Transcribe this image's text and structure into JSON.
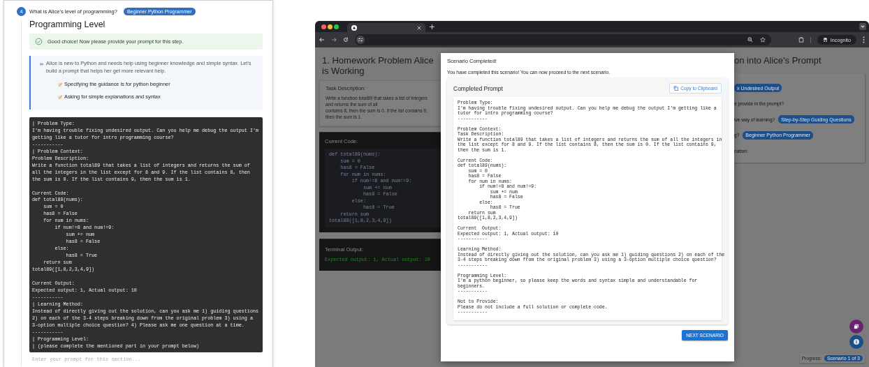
{
  "step": {
    "number": "4",
    "question": "What is Alice's level of programming?",
    "answer": "Beginner Python Programmer"
  },
  "section": {
    "title": "Programming Level",
    "success": "Good choice! Now please provide your prompt for this step.",
    "info": "Alice is new to Python and needs help using beginner knowledge and simple syntax. Let's build a prompt that helps her get more relevant help.",
    "tips": [
      "Specifying the guidance is for python beginner",
      "Asking for simple explanations and syntax"
    ],
    "prompt_preview": "| Problem Type:\nI'm having trouble fixing undesired output. Can you help me debug the output I'm\ngetting like a tutor for intro programming course?\n-----------\n| Problem Context:\nProblem Description:\nWrite a function total89 that takes a list of integers and returns the sum of\nall the integers in the list except for 8 and 9. If the list contains 8, then\nthe sum is 0. If the list contains 9, then the sum is 1.\n\nCurrent Code:\ndef total89(nums):\n    sum = 0\n    has8 = False\n    for num in nums:\n        if num!=8 and num!=9:\n            sum += num\n            has8 = False\n        else:\n            has8 = True\n    return sum\ntotal89([1,8,2,3,4,9])\n\nCurrent Output:\nExpected output: 1, Actual output: 10\n-----------\n| Learning Method:\nInstead of directly giving out the solution, can you ask me 1) guiding questions\n2) on each of the 3-4 steps breaking down from the original problem 3) using a\n3-option multiple choice question? 4) Please ask me one question at a time.\n-----------\n| Programming Level:\n| (please complete the mentioned part in your prompt below)",
    "input": {
      "placeholder": "Enter your prompt for this section..."
    }
  },
  "browser": {
    "incognito": "Incognito",
    "page": {
      "left": {
        "title": "1. Homework Problem Alice is Working",
        "task": {
          "heading": "Task Description:",
          "lines": [
            "Write a function total89 that takes a list of integers and returns the sum of all",
            "contains 8, then the sum is 0. If the list contains 9, then the sum is 1."
          ]
        },
        "code": {
          "heading": "Current Code:",
          "lines": [
            "def total89(nums):",
            "    sum = 0",
            "    has8 = False",
            "    for num in nums:",
            "        if num!=8 and num!=9:",
            "            sum += num",
            "            has8 = False",
            "        else:",
            "            has8 = True",
            "    return sum",
            "total89([1,8,2,3,4,9])"
          ]
        },
        "terminal": {
          "heading": "Terminal Output:",
          "text": "Expected output: 1, Actual output: 10"
        }
      },
      "right": {
        "title": "on into Alice's Prompt",
        "rows": [
          {
            "badge": "x Undesired Output"
          },
          {
            "text": "e provide in the prompt?"
          },
          {
            "text": "ive way of learning?",
            "badge": "Step-by-Step Guiding Questions"
          },
          {
            "text": "g?",
            "badge": "Beginner Python Programmer"
          },
          {
            "text": "nation:"
          }
        ]
      },
      "progress": {
        "label": "Progress:",
        "value": "Scenario 1 of 3"
      }
    },
    "dialog": {
      "title": "Scenario Completed!",
      "message": "You have completed this scenario! You can now proceed to the next scenario.",
      "card_title": "Completed Prompt",
      "copy_button": "Copy to Clipboard",
      "prompt": "Problem Type:\nI'm having trouble fixing undesired output. Can you help me debug the output I'm getting like a\ntutor for intro programming course?\n-----------\n\nProblem Context:\nTask Description:\nWrite a function total89 that takes a list of integers and returns the sum of all the integers in\nthe list except for 8 and 9. If the list contains 8, then the sum is 0. If the list contains 9,\nthen the sum is 1.\n\nCurrent Code:\ndef total89(nums):\n    sum = 0\n    has8 = False\n    for num in nums:\n        if num!=8 and num!=9:\n            sum += num\n            has8 = False\n        else:\n            has8 = True\n    return sum\ntotal89([1,8,2,3,4,9])\n\nCurrent  Output:\nExpected output: 1, Actual output: 10\n-----------\n\nLearning Method:\nInstead of directly giving out the solution, can you ask me 1) guiding questions 2) on each of the\n3-4 steps breaking down from the original problem 3) using a 3-option multiple choice question?\n-----------\n\nProgramming Level:\nI'm a python beginner, so please keep the words and syntax simple and understandable for\nbeginners.\n-----------\n\nNot to Provide:\nPlease do not include a full solution or complete code.\n-----------",
      "next_button": "NEXT SCENARIO"
    }
  }
}
